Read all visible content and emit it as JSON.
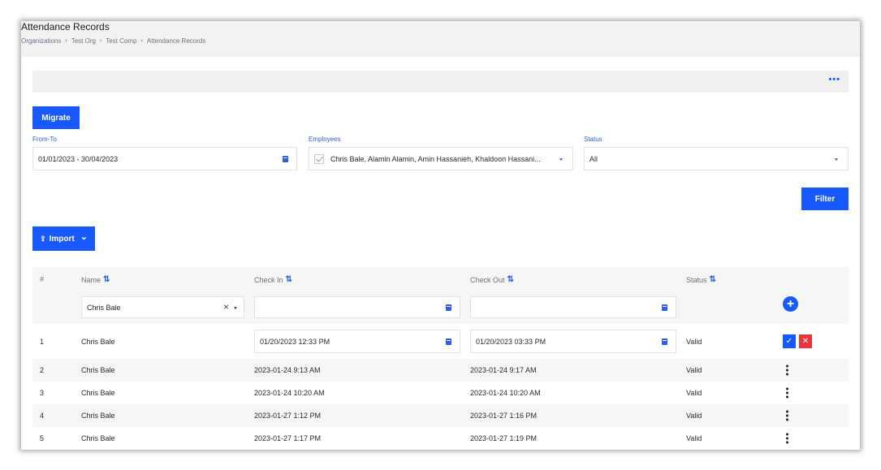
{
  "header": {
    "title": "Attendance Records",
    "breadcrumb": [
      "Organizations",
      "Test Org",
      "Test Comp",
      "Attendance Records"
    ],
    "breadcrumb_separator": "›"
  },
  "toolbar": {
    "more_icon": "more-horizontal-icon",
    "more_label": "•••"
  },
  "buttons": {
    "migrate": "Migrate",
    "filter": "Filter",
    "import": "Import",
    "import_icon": "upload-icon",
    "import_chevron": "⌄"
  },
  "filters": {
    "from_to": {
      "label": "From-To",
      "value": "01/01/2023 - 30/04/2023",
      "icon": "calendar-icon"
    },
    "employees": {
      "label": "Employees",
      "value": "Chris Bale, Alamin Alamin, Amin Hassanieh, Khaldoon Hassani...",
      "icon": "chevron-down-icon"
    },
    "status": {
      "label": "Status",
      "value": "All",
      "icon": "chevron-down-icon"
    }
  },
  "table": {
    "columns": {
      "index": "#",
      "name": "Name",
      "check_in": "Check In",
      "check_out": "Check Out",
      "status": "Status"
    },
    "sort_icon": "⇅",
    "filter_row": {
      "name_value": "Chris Bale",
      "clear_label": "×",
      "check_in_value": "",
      "check_out_value": "",
      "add_label": "+"
    },
    "edit_row": {
      "index": "1",
      "name": "Chris Bale",
      "check_in": "01/20/2023 12:33 PM",
      "check_out": "01/20/2023 03:33 PM",
      "status": "Valid",
      "save_label": "✓",
      "cancel_label": "✕"
    },
    "rows": [
      {
        "index": "2",
        "name": "Chris Bale",
        "check_in": "2023-01-24 9:13 AM",
        "check_out": "2023-01-24 9:17 AM",
        "status": "Valid"
      },
      {
        "index": "3",
        "name": "Chris Bale",
        "check_in": "2023-01-24 10:20 AM",
        "check_out": "2023-01-24 10:20 AM",
        "status": "Valid"
      },
      {
        "index": "4",
        "name": "Chris Bale",
        "check_in": "2023-01-27 1:12 PM",
        "check_out": "2023-01-27 1:16 PM",
        "status": "Valid"
      },
      {
        "index": "5",
        "name": "Chris Bale",
        "check_in": "2023-01-27 1:17 PM",
        "check_out": "2023-01-27 1:19 PM",
        "status": "Valid"
      }
    ]
  },
  "colors": {
    "primary": "#1759ff",
    "danger": "#e8343a",
    "label": "#2c5ee8",
    "header_bg": "#f2f2f2"
  }
}
